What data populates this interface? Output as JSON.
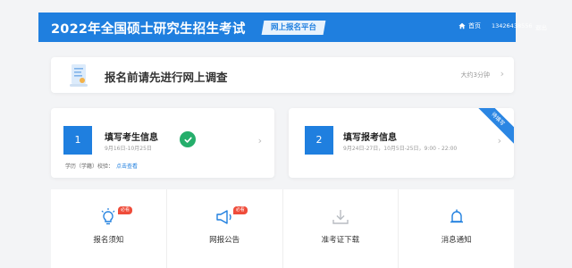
{
  "header": {
    "title": "2022年全国硕士研究生招生考试",
    "platform_label": "网上报名平台",
    "home_label": "首页",
    "phone": "13426438556",
    "logout_label": "退出",
    "color": "#1f7fdf"
  },
  "survey": {
    "icon": "document-icon",
    "text": "报名前请先进行网上调查",
    "duration": "大约3分钟"
  },
  "steps": [
    {
      "number": "1",
      "title": "填写考生信息",
      "date": "9月16日-10月25日",
      "status": "completed",
      "bottom_label": "学历（学籍）校验：",
      "bottom_link": "点击查看"
    },
    {
      "number": "2",
      "title": "填写报考信息",
      "date": "9月24日-27日，10月5日-25日，9:00 - 22:00",
      "corner_label": "待填写"
    }
  ],
  "tiles": [
    {
      "icon": "lightbulb-icon",
      "label": "报名须知",
      "tag": "必看"
    },
    {
      "icon": "megaphone-icon",
      "label": "网报公告",
      "tag": "必看"
    },
    {
      "icon": "download-icon",
      "label": "准考证下载",
      "tag": ""
    },
    {
      "icon": "bell-icon",
      "label": "消息通知",
      "tag": ""
    }
  ],
  "colors": {
    "accent": "#1f7fdf",
    "success": "#25ae6b",
    "tag": "#ef4c3a"
  }
}
